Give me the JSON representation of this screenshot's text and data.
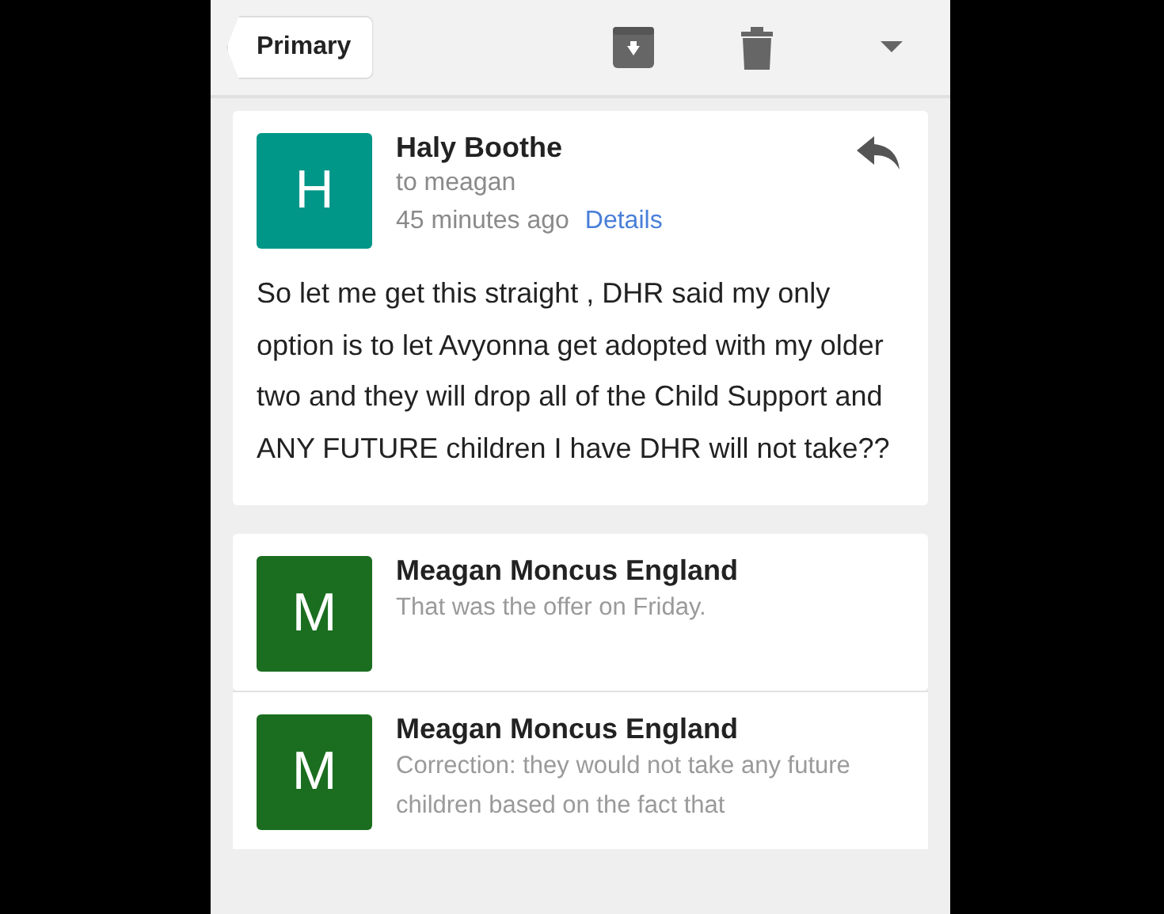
{
  "toolbar": {
    "back_label": "Primary"
  },
  "messages": [
    {
      "kind": "expanded",
      "initial": "H",
      "color": "#009688",
      "sender": "Haly Boothe",
      "recipient": "to meagan",
      "time": "45 minutes ago",
      "details_link": "Details",
      "body": "So let me get this straight , DHR said my only option is to let Avyonna get adopted with my older two and they will drop all of the Child Support and ANY FUTURE children I have DHR will not take??"
    },
    {
      "kind": "collapsed",
      "initial": "M",
      "color": "#1b6e20",
      "sender": "Meagan Moncus England",
      "snippet": "That was the offer on Friday."
    },
    {
      "kind": "collapsed",
      "initial": "M",
      "color": "#1b6e20",
      "sender": "Meagan Moncus England",
      "snippet": "Correction: they would not take any future children based on the fact that"
    }
  ]
}
